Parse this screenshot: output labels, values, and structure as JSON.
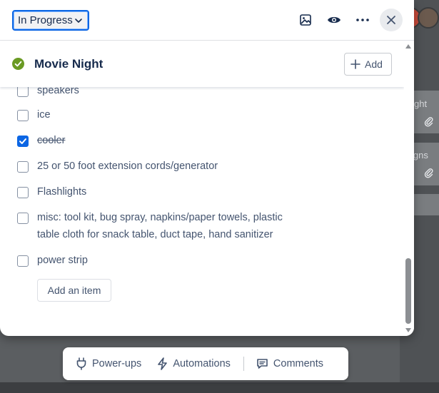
{
  "card": {
    "status": "In Progress",
    "section_title": "Movie Night",
    "add_label": "Add",
    "add_item_label": "Add an item"
  },
  "checklist": {
    "items": [
      {
        "text": "speakers",
        "checked": false
      },
      {
        "text": "ice",
        "checked": false
      },
      {
        "text": "cooler",
        "checked": true
      },
      {
        "text": "25  or 50 foot extension cords/generator",
        "checked": false
      },
      {
        "text": "Flashlights",
        "checked": false
      },
      {
        "text": "misc: tool kit, bug spray, napkins/paper towels, plastic table cloth for snack table, duct tape, hand sanitizer",
        "checked": false
      },
      {
        "text": "power strip",
        "checked": false
      }
    ]
  },
  "toolbar": {
    "powerups_label": "Power-ups",
    "automations_label": "Automations",
    "comments_label": "Comments"
  },
  "background": {
    "text_1": "ght",
    "text_2": "igns"
  },
  "icons": {
    "status_chevron": "chevron-down-icon",
    "cover": "image-icon",
    "watch": "eye-icon",
    "more": "more-horizontal-icon",
    "close": "close-icon",
    "complete": "check-circle-icon",
    "add": "plus-icon",
    "powerups": "plug-icon",
    "automations": "lightning-icon",
    "comments": "comment-icon"
  },
  "colors": {
    "accent": "#0c66e4",
    "complete": "#6a9a23"
  }
}
